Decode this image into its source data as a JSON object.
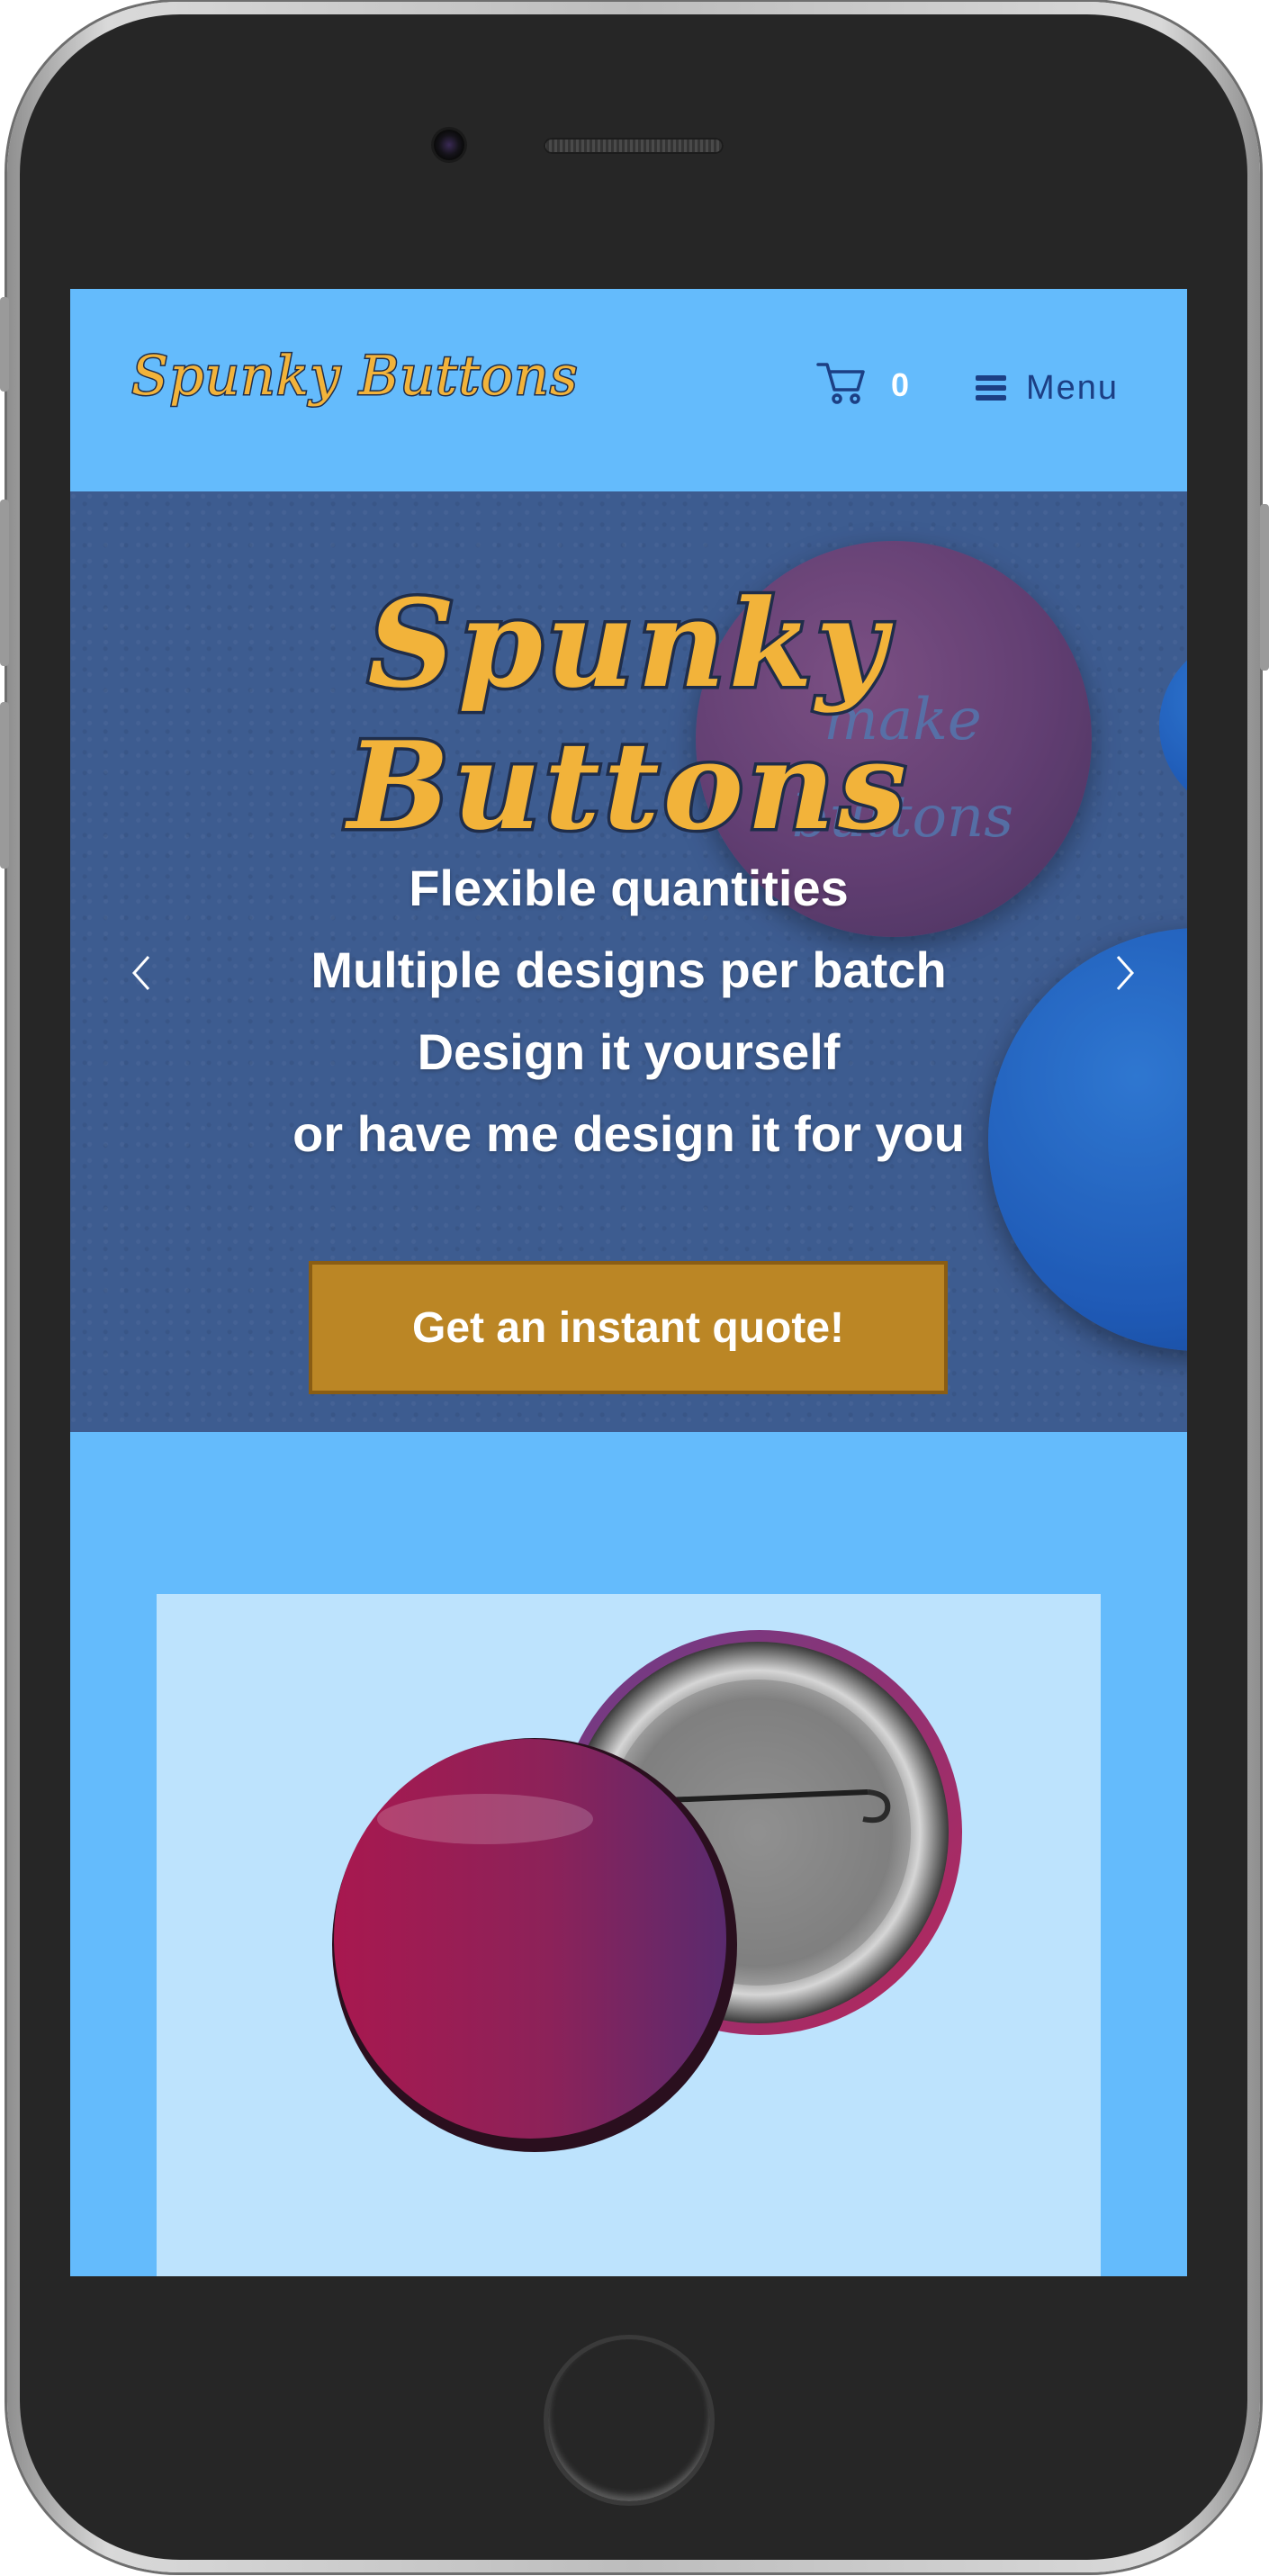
{
  "header": {
    "logo": "Spunky Buttons",
    "cart_count": "0",
    "menu_label": "Menu"
  },
  "hero": {
    "title": "Spunky Buttons",
    "background_pin_text_1": "make",
    "background_pin_text_2": "buttons",
    "lines": [
      "Flexible quantities",
      "Multiple designs per batch",
      "Design it yourself",
      "or have me design it for you"
    ],
    "cta_label": "Get an instant quote!"
  },
  "colors": {
    "page_background": "#64bbfc",
    "logo_fill": "#f2b33a",
    "logo_outline": "#1f2d4a",
    "menu_text": "#1c3f84",
    "cta_background": "#bb8625",
    "product_card_background": "#bde3fd"
  },
  "icons": {
    "cart": "shopping-cart-icon",
    "menu": "hamburger-menu-icon",
    "prev": "chevron-left-icon",
    "next": "chevron-right-icon"
  }
}
